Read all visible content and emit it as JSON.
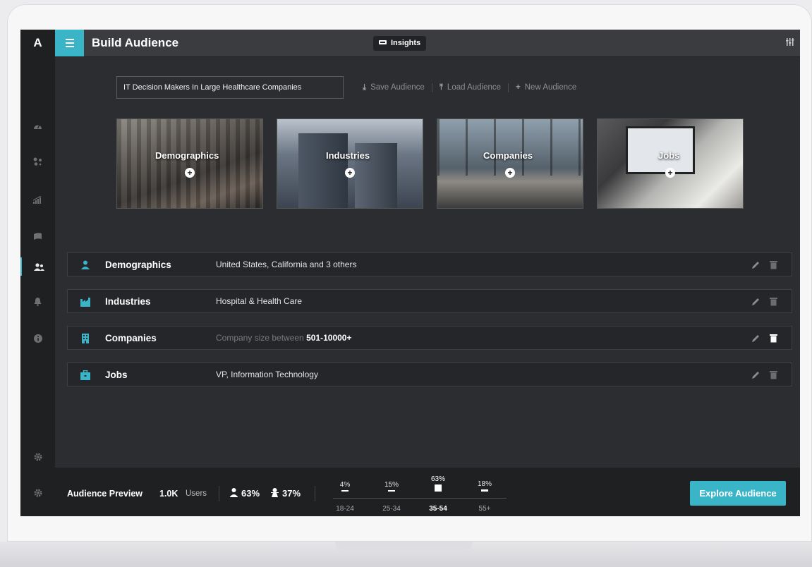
{
  "app": {
    "logo": "A",
    "title": "Build Audience",
    "insights_label": "Insights"
  },
  "accent_color": "#3ab4c7",
  "rail_icons": [
    "dashboard-icon",
    "segments-icon",
    "analytics-icon",
    "campaigns-icon",
    "audience-icon",
    "notifications-icon",
    "info-icon",
    "settings-icon",
    "preferences-icon"
  ],
  "audience": {
    "name": "IT Decision Makers In Large Healthcare Companies",
    "actions": {
      "save": "Save Audience",
      "load": "Load Audience",
      "new": "New Audience"
    }
  },
  "tiles": [
    {
      "label": "Demographics",
      "plus": "+"
    },
    {
      "label": "Industries",
      "plus": "+"
    },
    {
      "label": "Companies",
      "plus": "+"
    },
    {
      "label": "Jobs",
      "plus": "+"
    }
  ],
  "criteria": [
    {
      "name": "Demographics",
      "value": "United States, California and 3 others"
    },
    {
      "name": "Industries",
      "value": "Hospital & Health Care"
    },
    {
      "name": "Companies",
      "value_prefix": "Company size between",
      "value_strong": "501-10000+"
    },
    {
      "name": "Jobs",
      "value": "VP, Information Technology"
    }
  ],
  "preview": {
    "title": "Audience Preview",
    "count": "1.0K",
    "unit": "Users",
    "male_pct": "63%",
    "female_pct": "37%",
    "age_groups": [
      {
        "label": "18-24",
        "pct": "4%",
        "value": 4
      },
      {
        "label": "25-34",
        "pct": "15%",
        "value": 15
      },
      {
        "label": "35-54",
        "pct": "63%",
        "value": 63,
        "highlight": true
      },
      {
        "label": "55+",
        "pct": "18%",
        "value": 18
      }
    ]
  },
  "explore_label": "Explore Audience"
}
